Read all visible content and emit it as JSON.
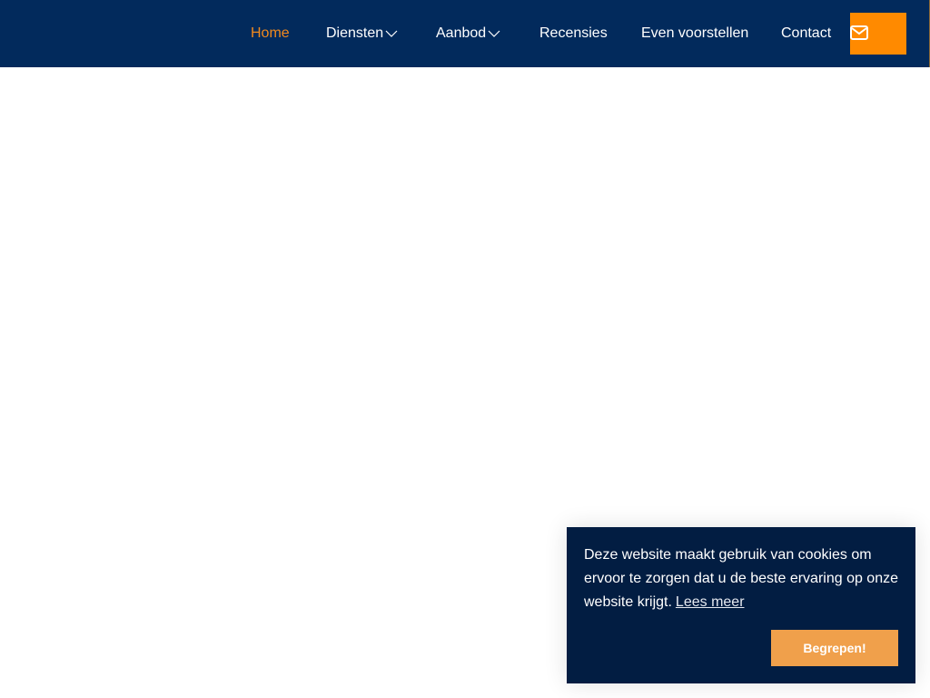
{
  "colors": {
    "navbar_bg": "#022a5c",
    "active_link": "#f28a1d",
    "mail_button_bg": "#ff8a00",
    "cookie_bg": "#021d42",
    "cookie_button_bg": "#f0a04b"
  },
  "nav": {
    "items": [
      {
        "label": "Home",
        "active": true
      },
      {
        "label": "Diensten",
        "dropdown": true,
        "icon": "chevron-down-icon"
      },
      {
        "label": "Aanbod",
        "dropdown": true,
        "icon": "chevron-down-icon"
      },
      {
        "label": "Recensies"
      },
      {
        "label": "Even voorstellen"
      },
      {
        "label": "Contact"
      }
    ],
    "mail_icon": "envelope-icon"
  },
  "cookie": {
    "message": "Deze website maakt gebruik van cookies om ervoor te zorgen dat u de beste ervaring op onze website krijgt.",
    "link_label": "Lees meer",
    "button_label": "Begrepen!"
  }
}
